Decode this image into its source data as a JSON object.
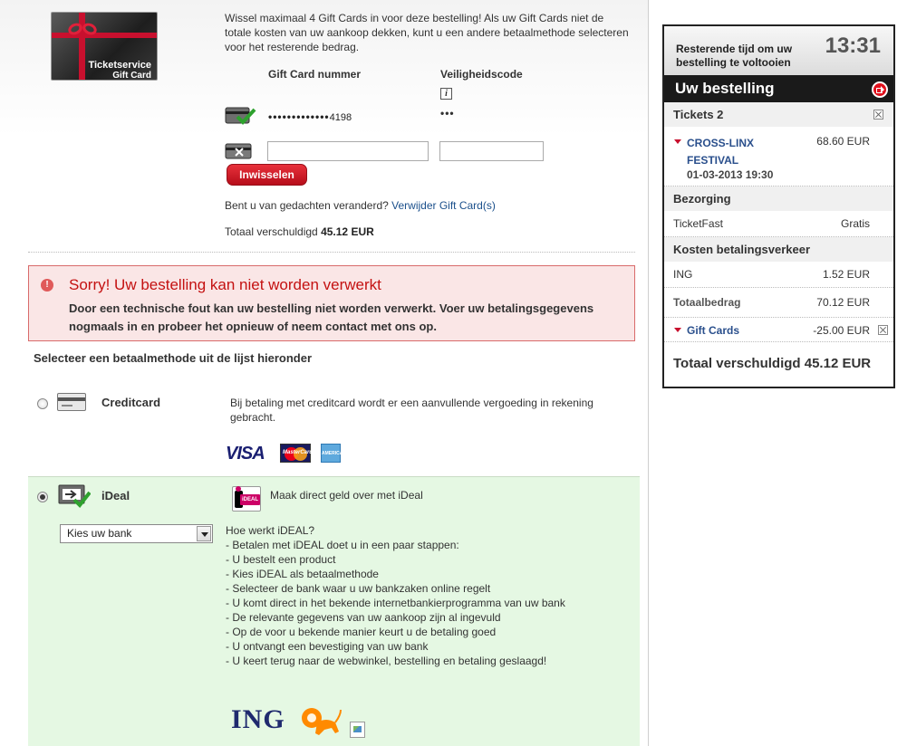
{
  "giftcard": {
    "card_brand": "Ticketservice",
    "card_type": "Gift Card",
    "intro": "Wissel maximaal 4 Gift Cards in voor deze bestelling! Als uw Gift Cards niet de totale kosten van uw aankoop dekken, kunt u een andere betaalmethode selecteren voor het resterende bedrag.",
    "col_number": "Gift Card nummer",
    "col_security": "Veiligheidscode",
    "info_icon": "i",
    "masked_number_dots": "•••••••••••••",
    "masked_number_last": "4198",
    "masked_security": "•••",
    "number_value": "",
    "security_value": "",
    "redeem_label": "Inwisselen",
    "change_mind_text": "Bent u van gedachten veranderd?",
    "remove_link": "Verwijder Gift Card(s)",
    "total_owed_label": "Totaal verschuldigd",
    "total_owed_value": "45.12 EUR"
  },
  "error": {
    "icon": "!",
    "title": "Sorry! Uw bestelling kan niet worden verwerkt",
    "text": "Door een technische fout kan uw bestelling niet worden verwerkt. Voer uw betalingsgegevens nogmaals in en probeer het opnieuw of neem contact met ons op."
  },
  "payment": {
    "select_title": "Selecteer een betaalmethode uit de lijst hieronder",
    "creditcard": {
      "label": "Creditcard",
      "description": "Bij betaling met creditcard wordt er een aanvullende vergoeding in rekening gebracht.",
      "visa": "VISA",
      "mastercard": "MasterCard",
      "amex": "AMERICAN EXPRESS",
      "selected": false
    },
    "ideal": {
      "label": "iDeal",
      "logo_text": "iDEAL",
      "tagline": "Maak direct geld over met iDeal",
      "bank_select": "Kies uw bank",
      "selected": true,
      "howto": [
        "Hoe werkt iDEAL?",
        "- Betalen met iDEAL doet u in een paar stappen:",
        "- U bestelt een product",
        "- Kies iDEAL als betaalmethode",
        "- Selecteer de bank waar u uw bankzaken online regelt",
        "- U komt direct in het bekende internetbankierprogramma van uw bank",
        "- De relevante gegevens van uw aankoop zijn al ingevuld",
        "- Op de voor u bekende manier keurt u de betaling goed",
        "- U ontvangt een bevestiging van uw bank",
        "- U keert terug naar de webwinkel, bestelling en betaling geslaagd!"
      ],
      "bank_logo": "ING"
    }
  },
  "sidebar": {
    "timer_label": "Resterende tijd om uw bestelling te voltooien",
    "timer_value": "13:31",
    "order_title": "Uw bestelling",
    "tickets_label": "Tickets 2",
    "event_name_1": "CROSS-LINX",
    "event_name_2": "FESTIVAL",
    "event_date": "01-03-2013 19:30",
    "event_price": "68.60 EUR",
    "delivery_head": "Bezorging",
    "delivery_method": "TicketFast",
    "delivery_price": "Gratis",
    "fees_head": "Kosten betalingsverkeer",
    "fee_method": "ING",
    "fee_value": "1.52 EUR",
    "total_label": "Totaalbedrag",
    "total_value": "70.12 EUR",
    "giftcards_label": "Gift Cards",
    "giftcards_value": "-25.00 EUR",
    "grand_total": "Totaal verschuldigd 45.12 EUR"
  },
  "colors": {
    "accent_red": "#c8102e",
    "error_bg": "#fae6e6",
    "ideal_bg": "#e5f8e3",
    "link_blue": "#1a4f8b"
  }
}
